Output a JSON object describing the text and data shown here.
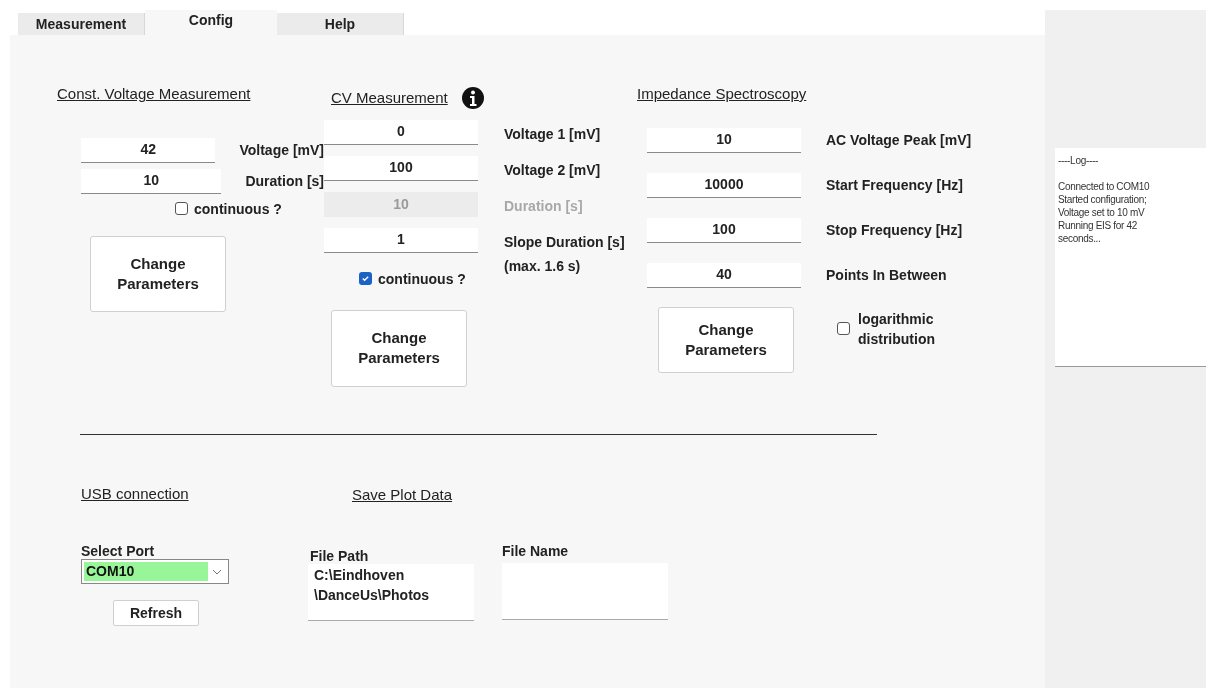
{
  "tabs": [
    {
      "label": "Measurement",
      "selected": false
    },
    {
      "label": "Config",
      "selected": true
    },
    {
      "label": "Help",
      "selected": false
    }
  ],
  "const_voltage": {
    "title": "Const. Voltage Measurement",
    "fields": [
      {
        "value": "42",
        "label": "Voltage [mV]"
      },
      {
        "value": "10",
        "label": "Duration [s]"
      }
    ],
    "continuous": {
      "label": "continuous ?",
      "checked": false
    },
    "button": "Change\nParameters"
  },
  "cv": {
    "title": "CV Measurement",
    "fields": [
      {
        "value": "0",
        "label": "Voltage 1 [mV]",
        "disabled": false
      },
      {
        "value": "100",
        "label": "Voltage 2 [mV]",
        "disabled": false
      },
      {
        "value": "10",
        "label": "Duration [s]",
        "disabled": true
      },
      {
        "value": "1",
        "label": "Slope Duration [s]\n(max. 1.6 s)",
        "disabled": false
      }
    ],
    "continuous": {
      "label": "continuous ?",
      "checked": true
    },
    "button": "Change\nParameters"
  },
  "eis": {
    "title": "Impedance Spectroscopy",
    "fields": [
      {
        "value": "10",
        "label": "AC Voltage Peak [mV]"
      },
      {
        "value": "10000",
        "label": "Start Frequency [Hz]"
      },
      {
        "value": "100",
        "label": "Stop Frequency [Hz]"
      },
      {
        "value": "40",
        "label": "Points In Between"
      }
    ],
    "logarithmic": {
      "label": "logarithmic\ndistribution",
      "checked": false
    },
    "button": "Change\nParameters"
  },
  "usb": {
    "title": "USB connection",
    "port": {
      "label": "Select Port",
      "value": "COM10"
    },
    "refresh": "Refresh"
  },
  "save": {
    "title": "Save Plot Data",
    "file_path": {
      "label": "File Path",
      "value": "C:\\Eindhoven\n\\DanceUs\\Photos"
    },
    "file_name": {
      "label": "File Name"
    }
  },
  "log": {
    "header": "----Log----",
    "lines": [
      "Connected to COM10",
      "Started configuration;",
      "Voltage set to 10 mV",
      "Running EIS for 42",
      "seconds..."
    ]
  }
}
